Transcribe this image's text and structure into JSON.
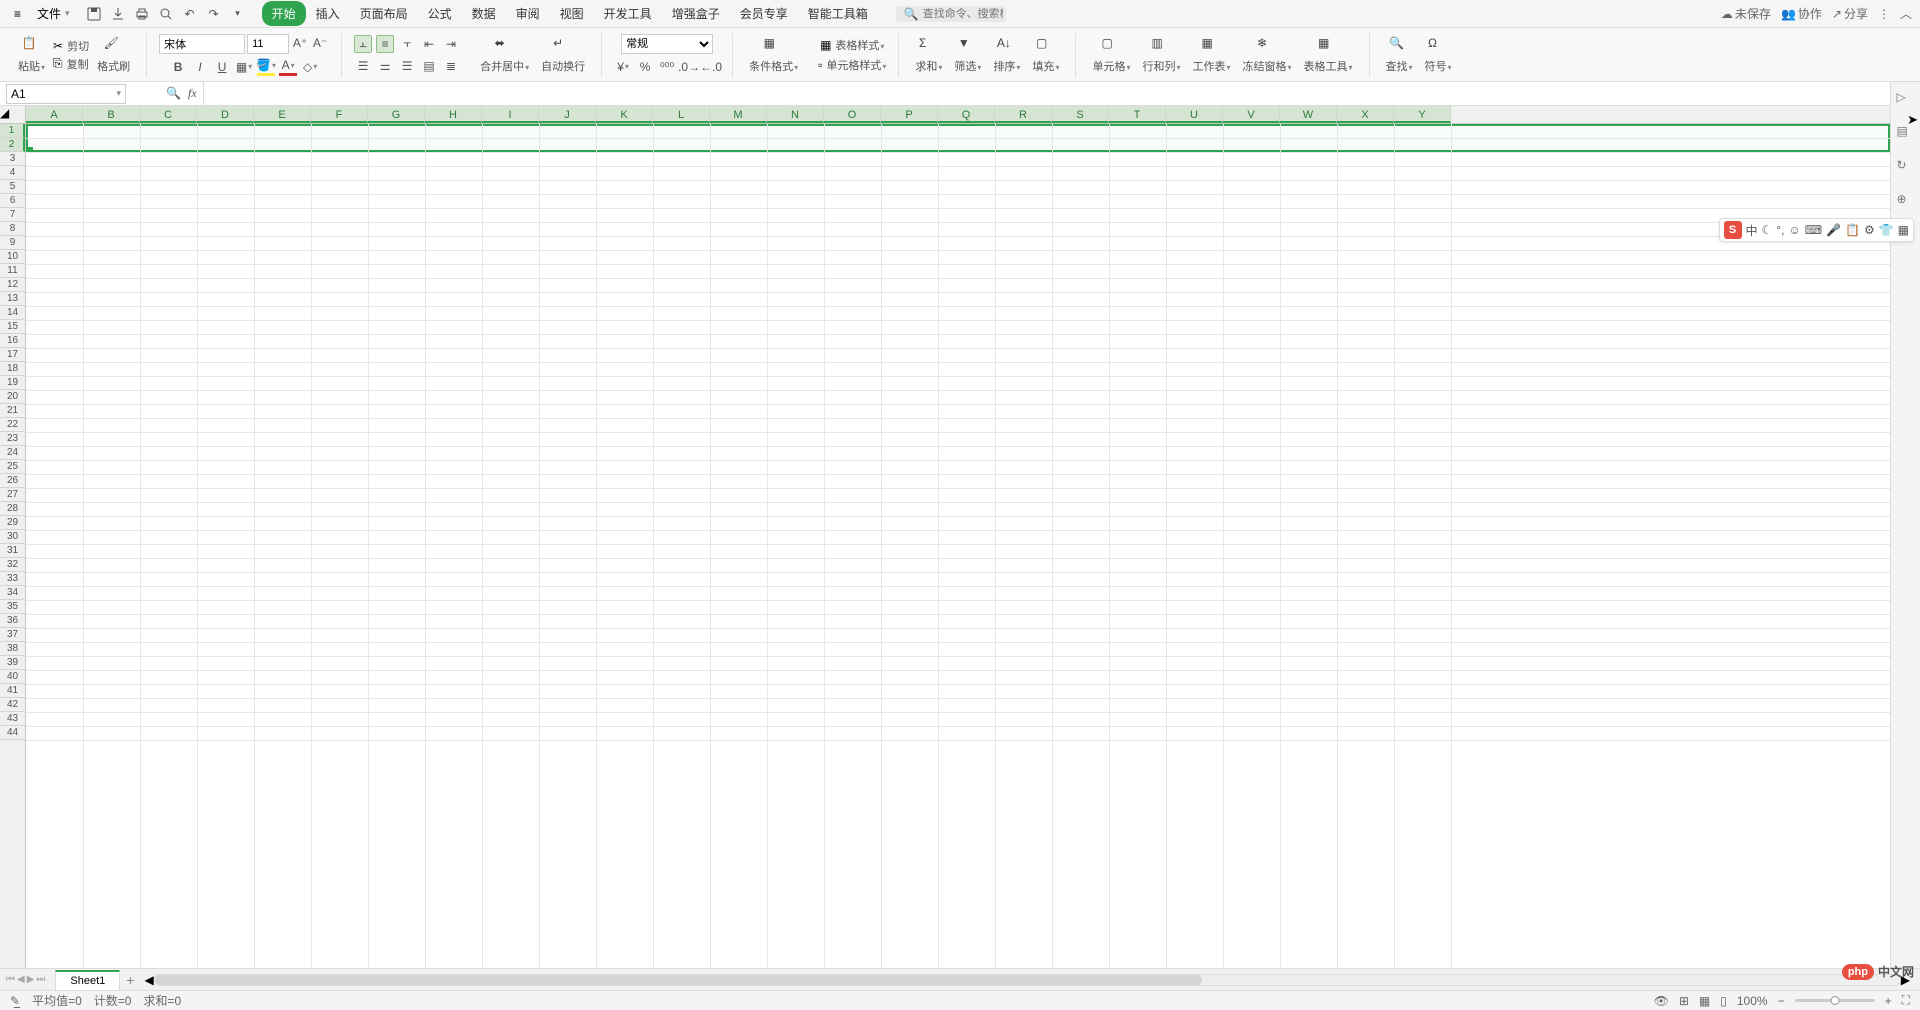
{
  "app": {
    "file_menu": "文件"
  },
  "tabs": [
    "开始",
    "插入",
    "页面布局",
    "公式",
    "数据",
    "审阅",
    "视图",
    "开发工具",
    "增强盒子",
    "会员专享",
    "智能工具箱"
  ],
  "active_tab": 0,
  "search_placeholder": "查找命令、搜索模板",
  "titlebar_right": {
    "unsaved": "未保存",
    "collab": "协作",
    "share": "分享"
  },
  "ribbon": {
    "paste": "粘贴",
    "cut": "剪切",
    "copy": "复制",
    "format_painter": "格式刷",
    "font_name": "宋体",
    "font_size": "11",
    "merge_center": "合并居中",
    "auto_wrap": "自动换行",
    "number_format": "常规",
    "cond_format": "条件格式",
    "table_style": "表格样式",
    "cell_style": "单元格样式",
    "sum": "求和",
    "filter": "筛选",
    "sort": "排序",
    "fill": "填充",
    "cell": "单元格",
    "row_col": "行和列",
    "worksheet": "工作表",
    "freeze": "冻结窗格",
    "table_tools": "表格工具",
    "find": "查找",
    "symbol": "符号"
  },
  "name_box": "A1",
  "fx_label": "fx",
  "columns": [
    "A",
    "B",
    "C",
    "D",
    "E",
    "F",
    "G",
    "H",
    "I",
    "J",
    "K",
    "L",
    "M",
    "N",
    "O",
    "P",
    "Q",
    "R",
    "S",
    "T",
    "U",
    "V",
    "W",
    "X",
    "Y"
  ],
  "row_count": 44,
  "selected_rows": [
    1,
    2
  ],
  "sheet_name": "Sheet1",
  "status": {
    "avg": "平均值=0",
    "count": "计数=0",
    "sum": "求和=0",
    "zoom": "100%"
  },
  "ime": {
    "brand": "S",
    "lang": "中",
    "icons": [
      "☾",
      "°,",
      "☺",
      "⌨",
      "🎤",
      "📋",
      "⚙",
      "👕",
      "▦"
    ]
  },
  "watermark": {
    "badge": "php",
    "text": "中文网"
  }
}
